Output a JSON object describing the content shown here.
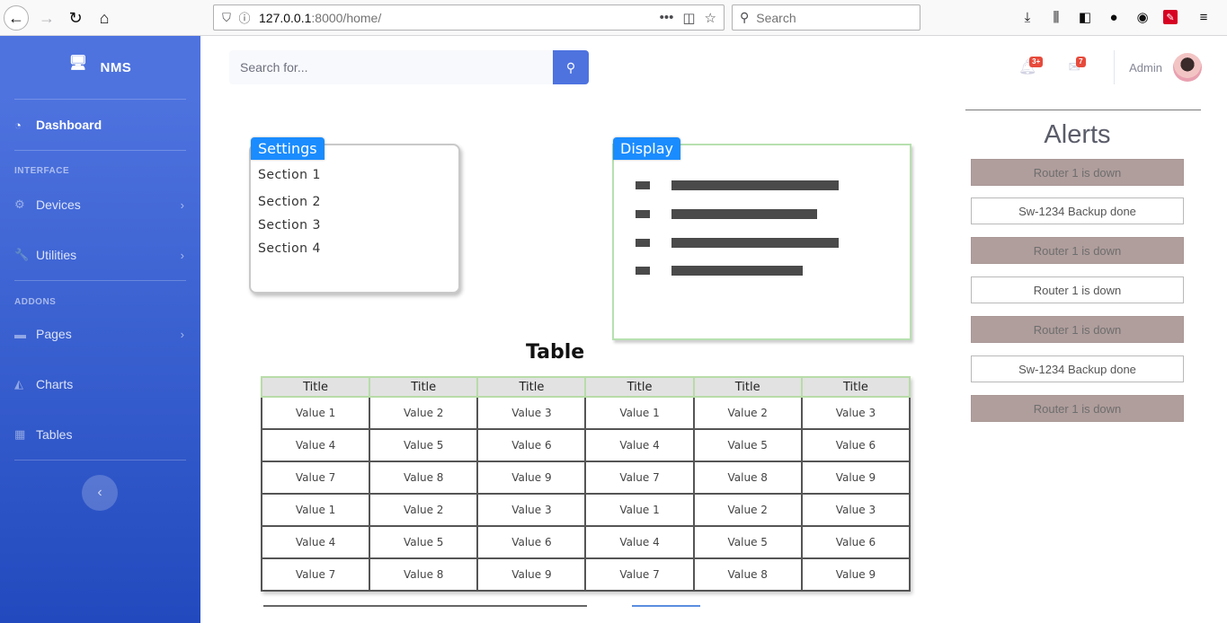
{
  "browser": {
    "url_host": "127.0.0.1",
    "url_rest": ":8000/home/",
    "search_placeholder": "Search",
    "more_icon": "ellipsis-icon"
  },
  "sidebar": {
    "brand": "NMS",
    "headings": {
      "interface": "INTERFACE",
      "addons": "ADDONS"
    },
    "items": [
      {
        "label": "Dashboard",
        "icon": "tachometer-icon"
      },
      {
        "label": "Devices",
        "icon": "cog-icon"
      },
      {
        "label": "Utilities",
        "icon": "wrench-icon"
      },
      {
        "label": "Pages",
        "icon": "folder-icon"
      },
      {
        "label": "Charts",
        "icon": "chart-area-icon"
      },
      {
        "label": "Tables",
        "icon": "table-icon"
      }
    ]
  },
  "topbar": {
    "search_placeholder": "Search for...",
    "alerts_badge": "3+",
    "messages_badge": "7",
    "user_name": "Admin"
  },
  "content": {
    "settings_tab": "Settings",
    "sections": [
      "Section 1",
      "Section 2",
      "Section 3",
      "Section 4"
    ],
    "display_tab": "Display",
    "table_title": "Table",
    "table_headers": [
      "Title",
      "Title",
      "Title",
      "Title",
      "Title",
      "Title"
    ],
    "table_rows": [
      [
        "Value 1",
        "Value 2",
        "Value 3",
        "Value 1",
        "Value 2",
        "Value 3"
      ],
      [
        "Value 4",
        "Value 5",
        "Value 6",
        "Value 4",
        "Value 5",
        "Value 6"
      ],
      [
        "Value 7",
        "Value 8",
        "Value 9",
        "Value 7",
        "Value 8",
        "Value 9"
      ],
      [
        "Value 1",
        "Value 2",
        "Value 3",
        "Value 1",
        "Value 2",
        "Value 3"
      ],
      [
        "Value 4",
        "Value 5",
        "Value 6",
        "Value 4",
        "Value 5",
        "Value 6"
      ],
      [
        "Value 7",
        "Value 8",
        "Value 9",
        "Value 7",
        "Value 8",
        "Value 9"
      ]
    ]
  },
  "alerts": {
    "title": "Alerts",
    "items": [
      {
        "text": "Router 1 is down",
        "status": "down"
      },
      {
        "text": "Sw-1234 Backup done",
        "status": "ok"
      },
      {
        "text": "Router 1 is down",
        "status": "down"
      },
      {
        "text": "Router 1 is down",
        "status": "ok"
      },
      {
        "text": "Router 1 is down",
        "status": "down"
      },
      {
        "text": "Sw-1234 Backup done",
        "status": "ok"
      },
      {
        "text": "Router 1 is down",
        "status": "down"
      }
    ]
  },
  "colors": {
    "sidebar_primary": "#4e73df",
    "sidebar_secondary": "#224abe",
    "alert_down": "#b09e9c",
    "badge": "#e74a3b"
  }
}
